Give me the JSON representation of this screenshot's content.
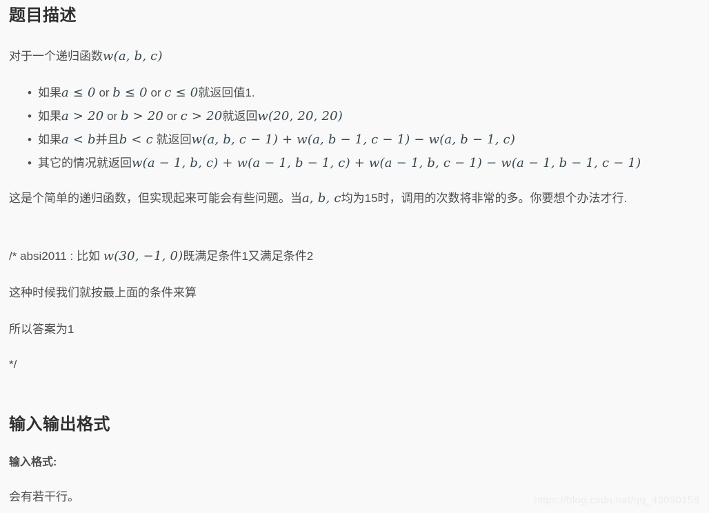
{
  "page": {
    "background_color": "#f9f9f9",
    "text_color": "#4f4f4f",
    "heading_color": "#2f2f2f",
    "math_color": "#37474f"
  },
  "headings": {
    "problem_description": "题目描述",
    "io_format": "输入输出格式",
    "input_format": "输入格式:"
  },
  "intro": {
    "text_before_math": "对于一个递归函数",
    "math": "w(a, b, c)"
  },
  "rules": [
    {
      "bullet": "•",
      "prefix": "如果",
      "math_1": "a ≤ 0",
      "sep_1": " or ",
      "math_2": "b ≤ 0",
      "sep_2": " or ",
      "math_3": "c ≤ 0",
      "suffix": "就返回值1."
    },
    {
      "bullet": "•",
      "prefix": "如果",
      "math_1": "a > 20",
      "sep_1": " or ",
      "math_2": "b > 20",
      "sep_2": " or ",
      "math_3": "c > 20",
      "suffix": "就返回",
      "math_tail": "w(20, 20, 20)"
    },
    {
      "bullet": "•",
      "prefix": "如果",
      "math_1": "a < b",
      "mid": "并且",
      "math_2": "b < c",
      "suffix": " 就返回",
      "math_tail": "w(a, b, c − 1) + w(a, b − 1, c − 1) − w(a, b − 1, c)"
    },
    {
      "bullet": "•",
      "prefix": "其它的情况就返回",
      "math_tail": "w(a − 1, b, c) + w(a − 1, b − 1, c) + w(a − 1, b, c − 1) − w(a − 1, b − 1, c − 1)"
    }
  ],
  "note": {
    "part_1": "这是个简单的递归函数，但实现起来可能会有些问题。当",
    "math": "a, b, c",
    "part_2": "均为15时，调用的次数将非常的多。你要想个办法才行."
  },
  "comment": {
    "open_line_prefix": "/* absi2011 : 比如 ",
    "open_line_math": "w(30, −1, 0)",
    "open_line_suffix": "既满足条件1又满足条件2",
    "line_2": "这种时候我们就按最上面的条件来算",
    "line_3": "所以答案为1",
    "close": "*/"
  },
  "input_section": {
    "body": "会有若干行。"
  },
  "watermark": {
    "text": "https://blog.csdn.net/qq_43090158"
  }
}
